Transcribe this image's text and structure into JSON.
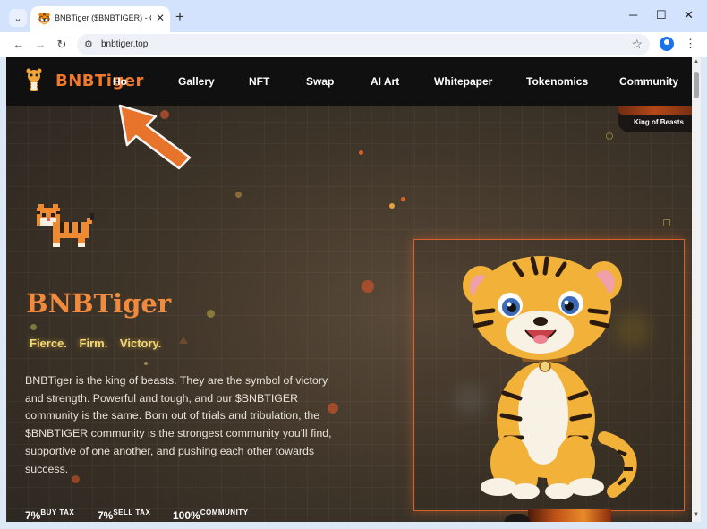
{
  "browser": {
    "tab_title": "BNBTiger ($BNBTIGER) - Comm",
    "url": "bnbtiger.top",
    "new_tab": "+",
    "controls": {
      "minimize": "─",
      "maximize": "☐",
      "close": "✕"
    }
  },
  "site": {
    "logo_text": "BNBTiger",
    "nav": {
      "home": "Ho",
      "items": [
        "Gallery",
        "NFT",
        "Swap",
        "AI Art",
        "Whitepaper",
        "Tokenomics",
        "Community"
      ]
    },
    "king_badge": "King of Beasts",
    "hero": {
      "title": "BNBTiger",
      "slogan": "Fierce. Firm. Victory.",
      "description": "BNBTiger is the king of beasts. They are the symbol of victory and strength. Powerful and tough, and our $BNBTIGER community is the same. Born out of trials and tribulation, the $BNBTIGER community is the strongest community you'll find, supportive of one another, and pushing each other towards success."
    },
    "stats": [
      {
        "value": "7%",
        "label": "BUY TAX"
      },
      {
        "value": "7%",
        "label": "SELL TAX"
      },
      {
        "value": "100%",
        "label": "COMMUNITY"
      }
    ]
  },
  "colors": {
    "accent": "#f07a2b",
    "slogan": "#f5d878",
    "annotation_arrow": "#e8742c"
  },
  "icons": [
    "tab-search-icon",
    "favicon-tiger-icon",
    "back-icon",
    "forward-icon",
    "reload-icon",
    "site-info-icon",
    "bookmark-star-icon",
    "profile-icon",
    "menu-icon",
    "annotation-arrow-icon"
  ]
}
